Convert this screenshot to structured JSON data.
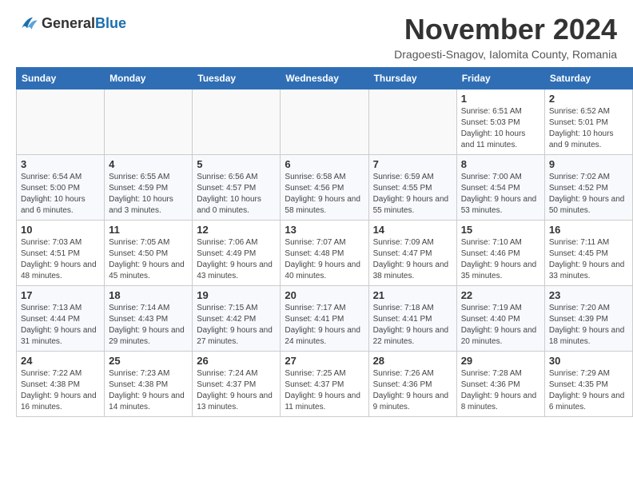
{
  "header": {
    "logo": {
      "general": "General",
      "blue": "Blue"
    },
    "title": "November 2024",
    "location": "Dragoesti-Snagov, Ialomita County, Romania"
  },
  "calendar": {
    "weekdays": [
      "Sunday",
      "Monday",
      "Tuesday",
      "Wednesday",
      "Thursday",
      "Friday",
      "Saturday"
    ],
    "weeks": [
      [
        {
          "day": "",
          "info": ""
        },
        {
          "day": "",
          "info": ""
        },
        {
          "day": "",
          "info": ""
        },
        {
          "day": "",
          "info": ""
        },
        {
          "day": "",
          "info": ""
        },
        {
          "day": "1",
          "info": "Sunrise: 6:51 AM\nSunset: 5:03 PM\nDaylight: 10 hours and 11 minutes."
        },
        {
          "day": "2",
          "info": "Sunrise: 6:52 AM\nSunset: 5:01 PM\nDaylight: 10 hours and 9 minutes."
        }
      ],
      [
        {
          "day": "3",
          "info": "Sunrise: 6:54 AM\nSunset: 5:00 PM\nDaylight: 10 hours and 6 minutes."
        },
        {
          "day": "4",
          "info": "Sunrise: 6:55 AM\nSunset: 4:59 PM\nDaylight: 10 hours and 3 minutes."
        },
        {
          "day": "5",
          "info": "Sunrise: 6:56 AM\nSunset: 4:57 PM\nDaylight: 10 hours and 0 minutes."
        },
        {
          "day": "6",
          "info": "Sunrise: 6:58 AM\nSunset: 4:56 PM\nDaylight: 9 hours and 58 minutes."
        },
        {
          "day": "7",
          "info": "Sunrise: 6:59 AM\nSunset: 4:55 PM\nDaylight: 9 hours and 55 minutes."
        },
        {
          "day": "8",
          "info": "Sunrise: 7:00 AM\nSunset: 4:54 PM\nDaylight: 9 hours and 53 minutes."
        },
        {
          "day": "9",
          "info": "Sunrise: 7:02 AM\nSunset: 4:52 PM\nDaylight: 9 hours and 50 minutes."
        }
      ],
      [
        {
          "day": "10",
          "info": "Sunrise: 7:03 AM\nSunset: 4:51 PM\nDaylight: 9 hours and 48 minutes."
        },
        {
          "day": "11",
          "info": "Sunrise: 7:05 AM\nSunset: 4:50 PM\nDaylight: 9 hours and 45 minutes."
        },
        {
          "day": "12",
          "info": "Sunrise: 7:06 AM\nSunset: 4:49 PM\nDaylight: 9 hours and 43 minutes."
        },
        {
          "day": "13",
          "info": "Sunrise: 7:07 AM\nSunset: 4:48 PM\nDaylight: 9 hours and 40 minutes."
        },
        {
          "day": "14",
          "info": "Sunrise: 7:09 AM\nSunset: 4:47 PM\nDaylight: 9 hours and 38 minutes."
        },
        {
          "day": "15",
          "info": "Sunrise: 7:10 AM\nSunset: 4:46 PM\nDaylight: 9 hours and 35 minutes."
        },
        {
          "day": "16",
          "info": "Sunrise: 7:11 AM\nSunset: 4:45 PM\nDaylight: 9 hours and 33 minutes."
        }
      ],
      [
        {
          "day": "17",
          "info": "Sunrise: 7:13 AM\nSunset: 4:44 PM\nDaylight: 9 hours and 31 minutes."
        },
        {
          "day": "18",
          "info": "Sunrise: 7:14 AM\nSunset: 4:43 PM\nDaylight: 9 hours and 29 minutes."
        },
        {
          "day": "19",
          "info": "Sunrise: 7:15 AM\nSunset: 4:42 PM\nDaylight: 9 hours and 27 minutes."
        },
        {
          "day": "20",
          "info": "Sunrise: 7:17 AM\nSunset: 4:41 PM\nDaylight: 9 hours and 24 minutes."
        },
        {
          "day": "21",
          "info": "Sunrise: 7:18 AM\nSunset: 4:41 PM\nDaylight: 9 hours and 22 minutes."
        },
        {
          "day": "22",
          "info": "Sunrise: 7:19 AM\nSunset: 4:40 PM\nDaylight: 9 hours and 20 minutes."
        },
        {
          "day": "23",
          "info": "Sunrise: 7:20 AM\nSunset: 4:39 PM\nDaylight: 9 hours and 18 minutes."
        }
      ],
      [
        {
          "day": "24",
          "info": "Sunrise: 7:22 AM\nSunset: 4:38 PM\nDaylight: 9 hours and 16 minutes."
        },
        {
          "day": "25",
          "info": "Sunrise: 7:23 AM\nSunset: 4:38 PM\nDaylight: 9 hours and 14 minutes."
        },
        {
          "day": "26",
          "info": "Sunrise: 7:24 AM\nSunset: 4:37 PM\nDaylight: 9 hours and 13 minutes."
        },
        {
          "day": "27",
          "info": "Sunrise: 7:25 AM\nSunset: 4:37 PM\nDaylight: 9 hours and 11 minutes."
        },
        {
          "day": "28",
          "info": "Sunrise: 7:26 AM\nSunset: 4:36 PM\nDaylight: 9 hours and 9 minutes."
        },
        {
          "day": "29",
          "info": "Sunrise: 7:28 AM\nSunset: 4:36 PM\nDaylight: 9 hours and 8 minutes."
        },
        {
          "day": "30",
          "info": "Sunrise: 7:29 AM\nSunset: 4:35 PM\nDaylight: 9 hours and 6 minutes."
        }
      ]
    ]
  }
}
